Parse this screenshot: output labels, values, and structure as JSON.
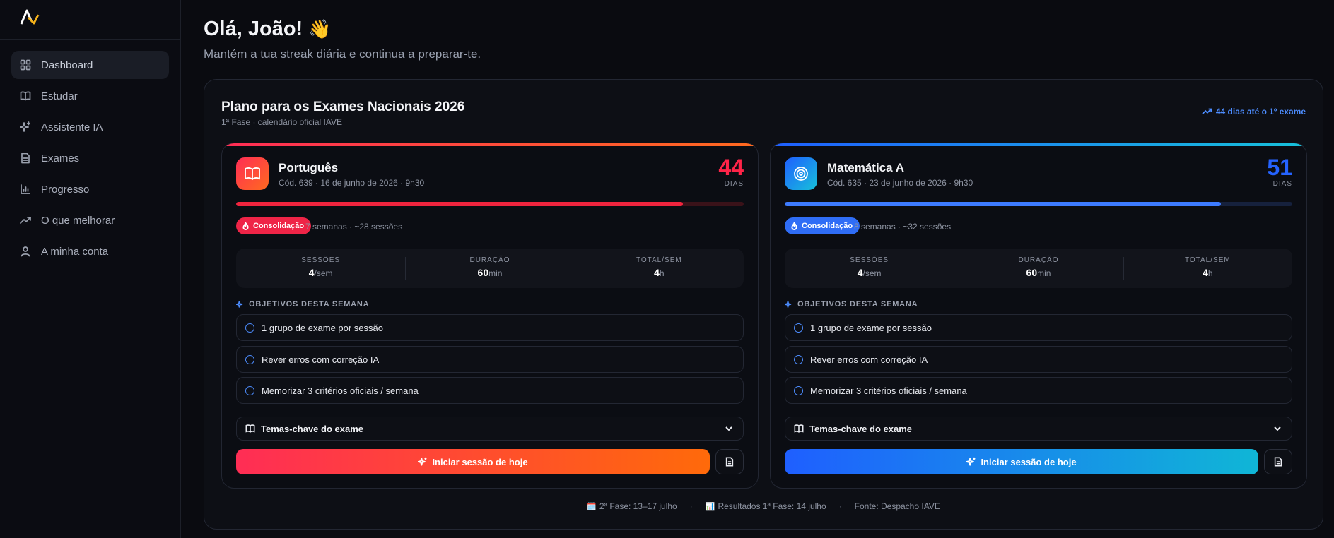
{
  "sidebar": {
    "items": [
      {
        "label": "Dashboard",
        "icon": "dashboard-icon",
        "active": true
      },
      {
        "label": "Estudar",
        "icon": "book-icon"
      },
      {
        "label": "Assistente IA",
        "icon": "sparkles-icon"
      },
      {
        "label": "Exames",
        "icon": "file-icon"
      },
      {
        "label": "Progresso",
        "icon": "bar-chart-icon"
      },
      {
        "label": "O que melhorar",
        "icon": "trending-up-icon"
      },
      {
        "label": "A minha conta",
        "icon": "user-icon"
      }
    ]
  },
  "header": {
    "greeting": "Olá, João!",
    "wave": "👋",
    "subtitle": "Mantém a tua streak diária e continua a preparar-te."
  },
  "plan": {
    "title": "Plano para os Exames Nacionais 2026",
    "subtitle": "1ª Fase · calendário oficial IAVE",
    "countdown": "44 dias até o 1º exame",
    "exams": [
      {
        "name": "Português",
        "meta": "Cód. 639 · 16 de junho de 2026 · 9h30",
        "days": "44",
        "days_label": "DIAS",
        "progress": 0.88,
        "phase": "Consolidação",
        "phase_info": "7 semanas · ~28 sessões",
        "stats": [
          {
            "label": "SESSÕES",
            "value": "4",
            "unit": "/sem"
          },
          {
            "label": "DURAÇÃO",
            "value": "60",
            "unit": "min"
          },
          {
            "label": "TOTAL/SEM",
            "value": "4",
            "unit": "h"
          }
        ],
        "objectives_title": "OBJETIVOS DESTA SEMANA",
        "objectives": [
          "1 grupo de exame por sessão",
          "Rever erros com correção IA",
          "Memorizar 3 critérios oficiais / semana"
        ],
        "topics": "Temas-chave do exame",
        "start": "Iniciar sessão de hoje",
        "accent": "#ff2d55"
      },
      {
        "name": "Matemática A",
        "meta": "Cód. 635 · 23 de junho de 2026 · 9h30",
        "days": "51",
        "days_label": "DIAS",
        "progress": 0.86,
        "phase": "Consolidação",
        "phase_info": "8 semanas · ~32 sessões",
        "stats": [
          {
            "label": "SESSÕES",
            "value": "4",
            "unit": "/sem"
          },
          {
            "label": "DURAÇÃO",
            "value": "60",
            "unit": "min"
          },
          {
            "label": "TOTAL/SEM",
            "value": "4",
            "unit": "h"
          }
        ],
        "objectives_title": "OBJETIVOS DESTA SEMANA",
        "objectives": [
          "1 grupo de exame por sessão",
          "Rever erros com correção IA",
          "Memorizar 3 critérios oficiais / semana"
        ],
        "topics": "Temas-chave do exame",
        "start": "Iniciar sessão de hoje",
        "accent": "#1f5fff"
      }
    ],
    "footer": {
      "phase2_emoji": "🗓️",
      "phase2": "2ª Fase: 13–17 julho",
      "results_emoji": "📊",
      "results": "Resultados 1ª Fase: 14 julho",
      "source": "Fonte: Despacho IAVE",
      "sep": "·"
    }
  }
}
